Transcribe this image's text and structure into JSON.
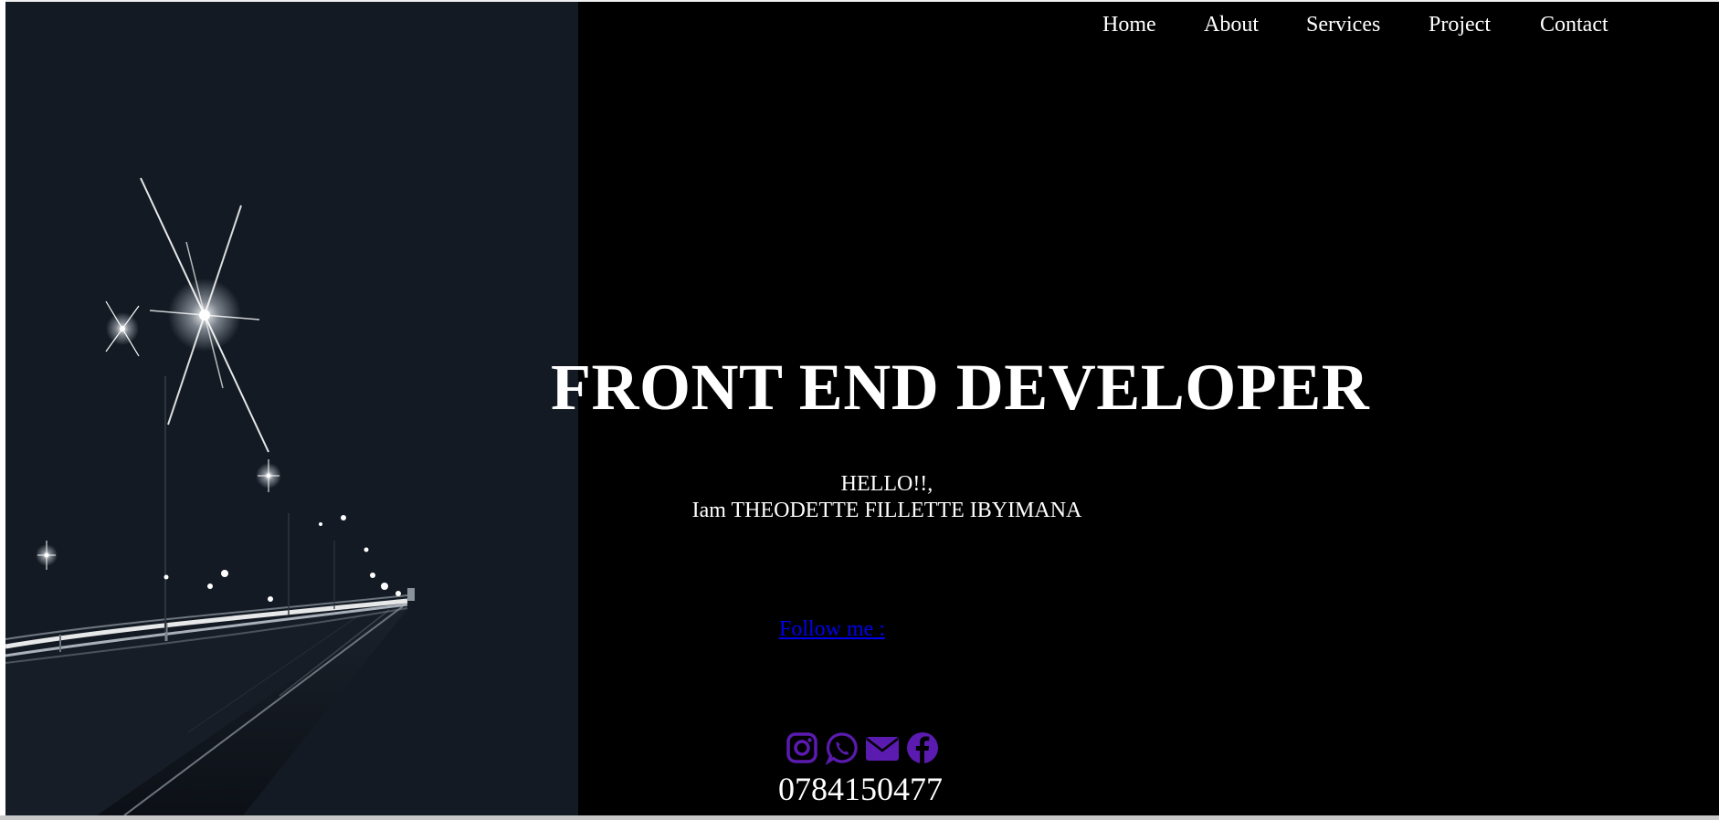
{
  "nav": {
    "items": [
      {
        "label": "Home"
      },
      {
        "label": "About"
      },
      {
        "label": "Services"
      },
      {
        "label": "Project"
      },
      {
        "label": "Contact"
      }
    ]
  },
  "hero": {
    "headline": "FRONT END DEVELOPER",
    "greeting_line1": "HELLO!!,",
    "greeting_line2": "Iam THEODETTE FILLETTE IBYIMANA",
    "follow_label": "Follow me :",
    "phone": "0784150477"
  },
  "socials": [
    {
      "icon": "instagram-icon"
    },
    {
      "icon": "whatsapp-icon"
    },
    {
      "icon": "envelope-icon"
    },
    {
      "icon": "facebook-icon"
    }
  ],
  "colors": {
    "background": "#000000",
    "text": "#ffffff",
    "link": "#0000ee",
    "icon": "#5b1bb0",
    "image_bg": "#131a23"
  }
}
